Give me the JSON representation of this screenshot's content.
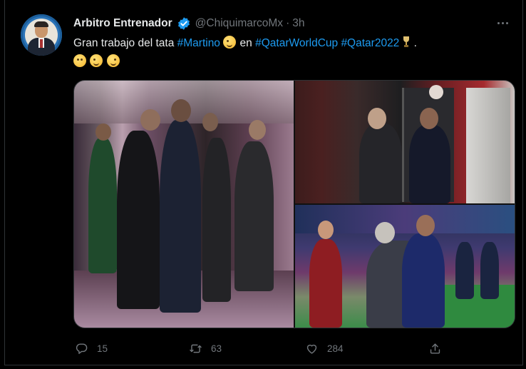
{
  "tweet": {
    "author_name": "Arbitro Entrenador",
    "handle": "@ChiquimarcoMx",
    "separator": "·",
    "time": "3h",
    "text": {
      "t1": "Gran trabajo del tata ",
      "hashtag1": "#Martino",
      "t2": " en ",
      "hashtag2": "#QatarWorldCup",
      "t3": " ",
      "hashtag3": "#Qatar2022",
      "t4": " ."
    },
    "emojis": [
      "winking-face",
      "thinking-face",
      "zany-face",
      "rofl-face"
    ],
    "media_count": 3,
    "actions": {
      "replies": "15",
      "retweets": "63",
      "likes": "284"
    }
  },
  "colors": {
    "background": "#000000",
    "text": "#e7e9ea",
    "secondary": "#71767b",
    "link": "#1d9bf0",
    "verified": "#1d9bf0"
  }
}
